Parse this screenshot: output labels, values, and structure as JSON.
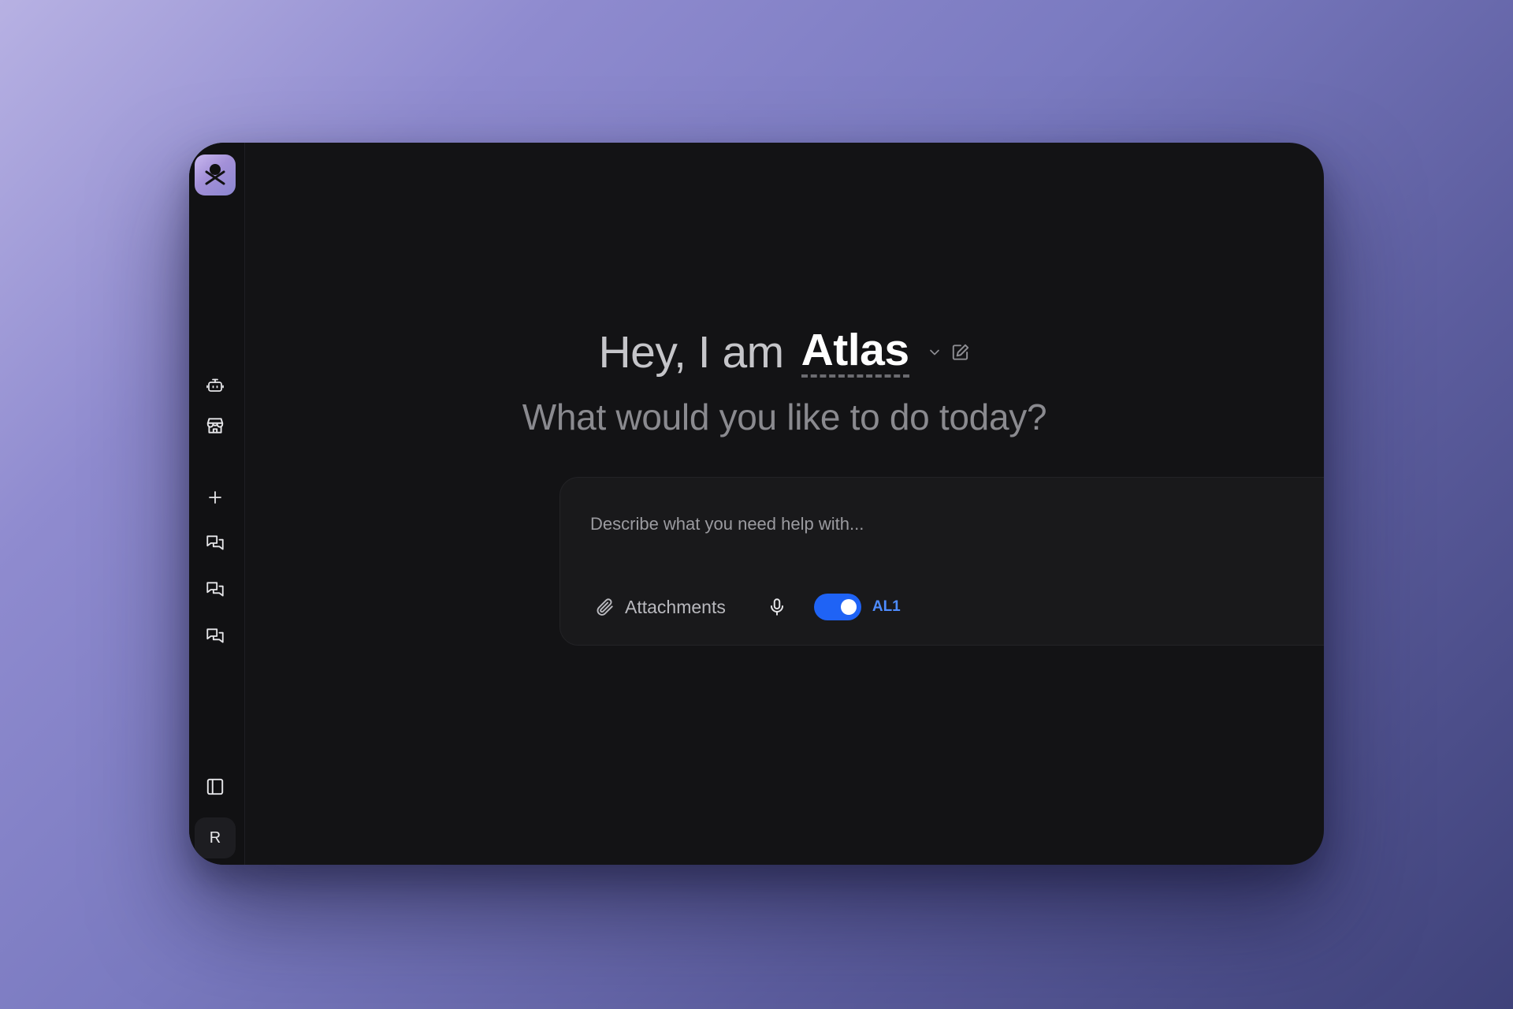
{
  "app": {
    "agent_prefix": "Hey, I am",
    "agent_name": "Atlas",
    "subtitle": "What would you like to do today?"
  },
  "sidebar": {
    "items": [
      {
        "icon": "bot-icon"
      },
      {
        "icon": "store-icon"
      },
      {
        "icon": "plus-icon"
      },
      {
        "icon": "chat-icon"
      },
      {
        "icon": "chat-icon"
      },
      {
        "icon": "chat-icon"
      },
      {
        "icon": "sidebar-toggle-icon"
      }
    ],
    "user_initial": "R"
  },
  "prompt": {
    "placeholder": "Describe what you need help with...",
    "value": "",
    "attachments_label": "Attachments",
    "toggle_on": true,
    "toggle_label": "AL1"
  },
  "colors": {
    "accent": "#1f63f5",
    "toggle_label": "#4e8cff",
    "window_bg": "#131315"
  }
}
